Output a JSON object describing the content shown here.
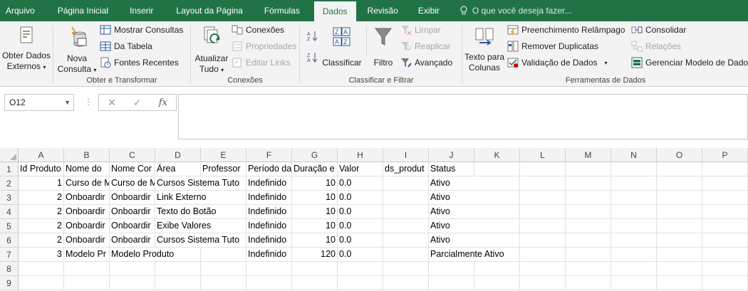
{
  "tabs": [
    "Arquivo",
    "Página Inicial",
    "Inserir",
    "Layout da Página",
    "Fórmulas",
    "Dados",
    "Revisão",
    "Exibir"
  ],
  "active_tab": "Dados",
  "tell_me": "O que você deseja fazer...",
  "ribbon": {
    "obter_dados": {
      "line1": "Obter Dados",
      "line2": "Externos"
    },
    "nova_consulta": {
      "line1": "Nova",
      "line2": "Consulta"
    },
    "mostrar_consultas": "Mostrar Consultas",
    "da_tabela": "Da Tabela",
    "fontes_recentes": "Fontes Recentes",
    "group_obter": "Obter e Transformar",
    "atualizar": {
      "line1": "Atualizar",
      "line2": "Tudo"
    },
    "conexoes": "Conexões",
    "propriedades": "Propriedades",
    "editar_links": "Editar Links",
    "group_conexoes": "Conexões",
    "classificar": "Classificar",
    "filtro": "Filtro",
    "limpar": "Limpar",
    "reaplicar": "Reaplicar",
    "avancado": "Avançado",
    "group_classificar": "Classificar e Filtrar",
    "texto_colunas": {
      "line1": "Texto para",
      "line2": "Colunas"
    },
    "preenchimento": "Preenchimento Relâmpago",
    "remover_duplicatas": "Remover Duplicatas",
    "validacao": "Validação de Dados",
    "consolidar": "Consolidar",
    "relacoes": "Relações",
    "gerenciar": "Gerenciar Modelo de Dados",
    "group_ferramentas": "Ferramentas de Dados"
  },
  "name_box": "O12",
  "columns": [
    "A",
    "B",
    "C",
    "D",
    "E",
    "F",
    "G",
    "H",
    "I",
    "J",
    "K",
    "L",
    "M",
    "N",
    "O",
    "P"
  ],
  "rows": [
    "1",
    "2",
    "3",
    "4",
    "5",
    "6",
    "7",
    "8",
    "9"
  ],
  "cells": [
    [
      "Id Produto",
      "Nome do",
      "Nome Cor",
      "Área",
      "Professor",
      "Período da",
      "Duração e",
      "Valor",
      "ds_produt",
      "Status"
    ],
    [
      "1",
      "Curso de M",
      "Curso de M",
      "Cursos Sistema Tuto",
      "",
      "Indefinido",
      "10",
      "0.0",
      "",
      "Ativo"
    ],
    [
      "2",
      "Onboardir",
      "Onboardir",
      "Link Externo",
      "",
      "Indefinido",
      "10",
      "0.0",
      "",
      "Ativo"
    ],
    [
      "2",
      "Onboardir",
      "Onboardir",
      "Texto do Botão",
      "",
      "Indefinido",
      "10",
      "0.0",
      "",
      "Ativo"
    ],
    [
      "2",
      "Onboardir",
      "Onboardir",
      "Exibe Valores",
      "",
      "Indefinido",
      "10",
      "0.0",
      "",
      "Ativo"
    ],
    [
      "2",
      "Onboardir",
      "Onboardir",
      "Cursos Sistema Tuto",
      "",
      "Indefinido",
      "10",
      "0.0",
      "",
      "Ativo"
    ],
    [
      "3",
      "Modelo Pr",
      "Modelo Produto",
      "",
      "",
      "Indefinido",
      "120",
      "0.0",
      "",
      "Parcialmente Ativo"
    ]
  ],
  "colors": {
    "brand": "#217346",
    "ribbon_bg": "#f3f3f3",
    "grid_line": "#e1e1e1"
  }
}
